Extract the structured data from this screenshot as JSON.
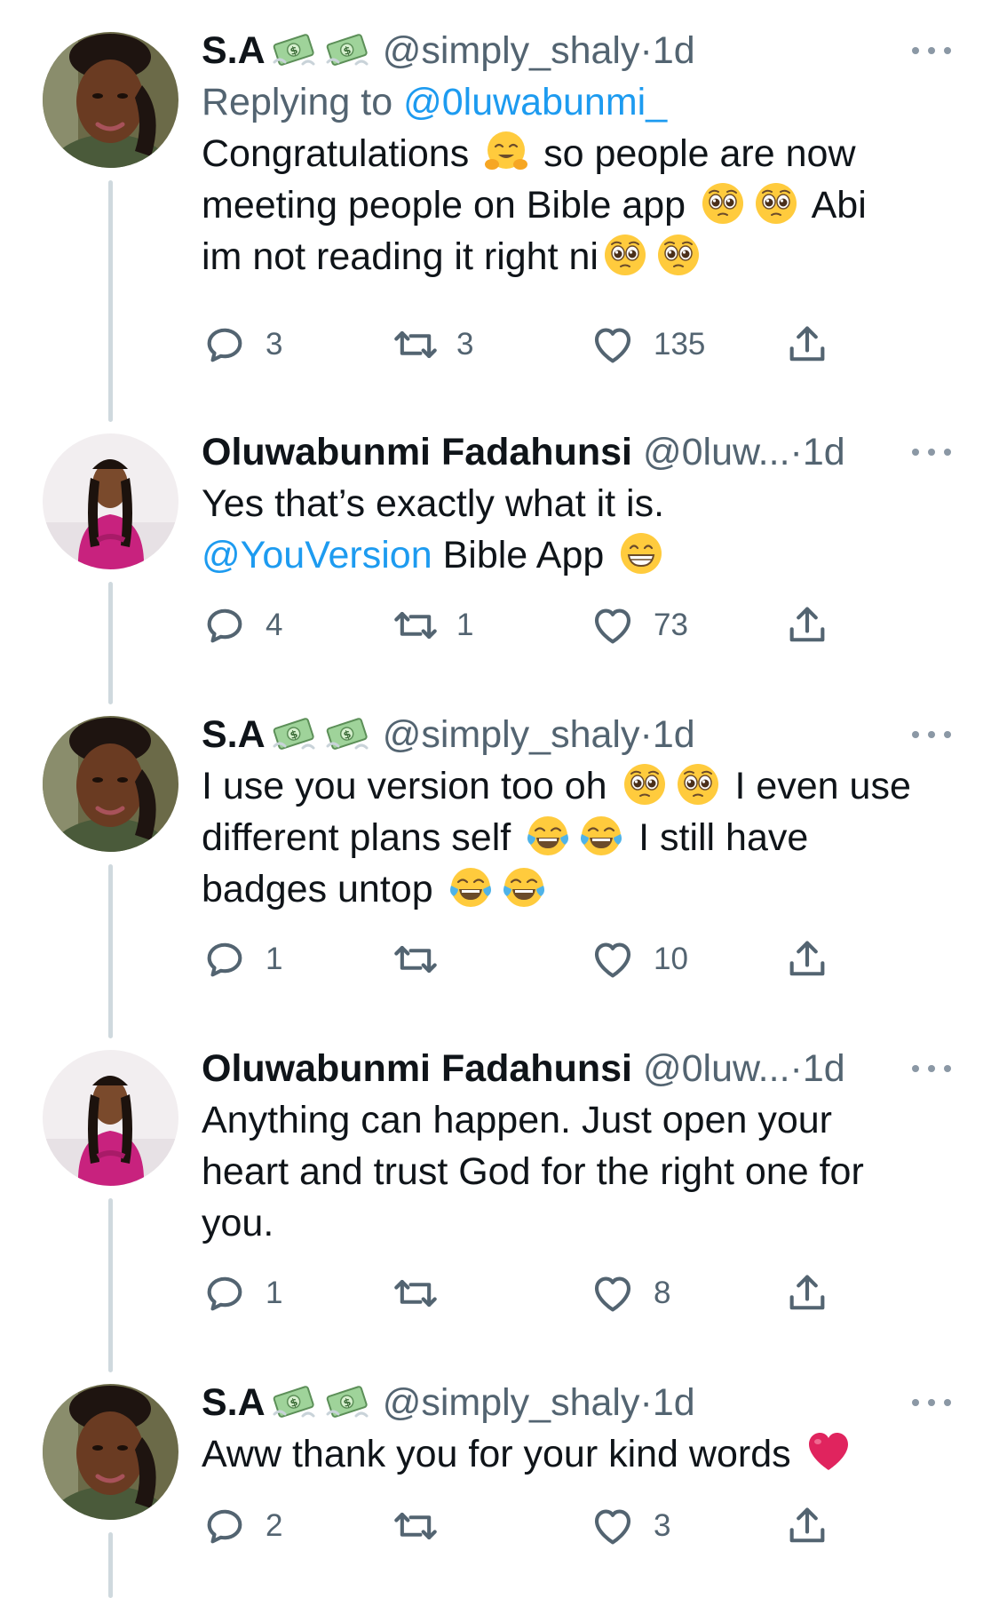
{
  "tweets": [
    {
      "author": "S.A",
      "author_emojis": [
        "money-with-wings",
        "money-with-wings"
      ],
      "handle": "@simply_shaly",
      "time": "1d",
      "replying_prefix": "Replying to",
      "replying_to": "@0luwabunmi_",
      "body": [
        [
          "Congratulations ",
          "hugging-face",
          " so people are now"
        ],
        [
          "meeting people on Bible app ",
          "pleading-face",
          "pleading-face",
          " Abi"
        ],
        [
          "im not reading it right ni",
          "pleading-face",
          "pleading-face"
        ]
      ],
      "replies": "3",
      "retweets": "3",
      "likes": "135"
    },
    {
      "author": "Oluwabunmi Fadahunsi",
      "handle": "@0luw...",
      "time": "1d",
      "body_line1": "Yes that’s exactly what it is.",
      "body_mention": "@YouVersion",
      "body_line2_rest": " Bible App ",
      "body_emoji": "grinning-face",
      "replies": "4",
      "retweets": "1",
      "likes": "73"
    },
    {
      "author": "S.A",
      "handle": "@simply_shaly",
      "time": "1d",
      "body_line1_a": "I use you version too oh ",
      "body_line1_b": " I even use",
      "body_line2_a": "different plans self ",
      "body_line2_b": " I still have",
      "body_line3_a": "badges untop ",
      "emojis": [
        "pleading-face",
        "tears-of-joy-face"
      ],
      "replies": "1",
      "retweets": "",
      "likes": "10"
    },
    {
      "author": "Oluwabunmi Fadahunsi",
      "handle": "@0luw...",
      "time": "1d",
      "body_line1": "Anything can happen. Just open your",
      "body_line2": "heart and trust God for the right one for",
      "body_line3": "you.",
      "replies": "1",
      "retweets": "",
      "likes": "8"
    },
    {
      "author": "S.A",
      "handle": "@simply_shaly",
      "time": "1d",
      "body_line1": "Aww thank you for your kind words ",
      "body_emoji": "red-heart",
      "replies": "2",
      "retweets": "",
      "likes": "3"
    }
  ],
  "separator": "·",
  "colors": {
    "text": "#0f1419",
    "secondary": "#536471",
    "link": "#1d9bf0",
    "thread_line": "#cfd9de"
  },
  "icons": [
    "reply-icon",
    "retweet-icon",
    "like-icon",
    "share-icon",
    "more-icon"
  ]
}
